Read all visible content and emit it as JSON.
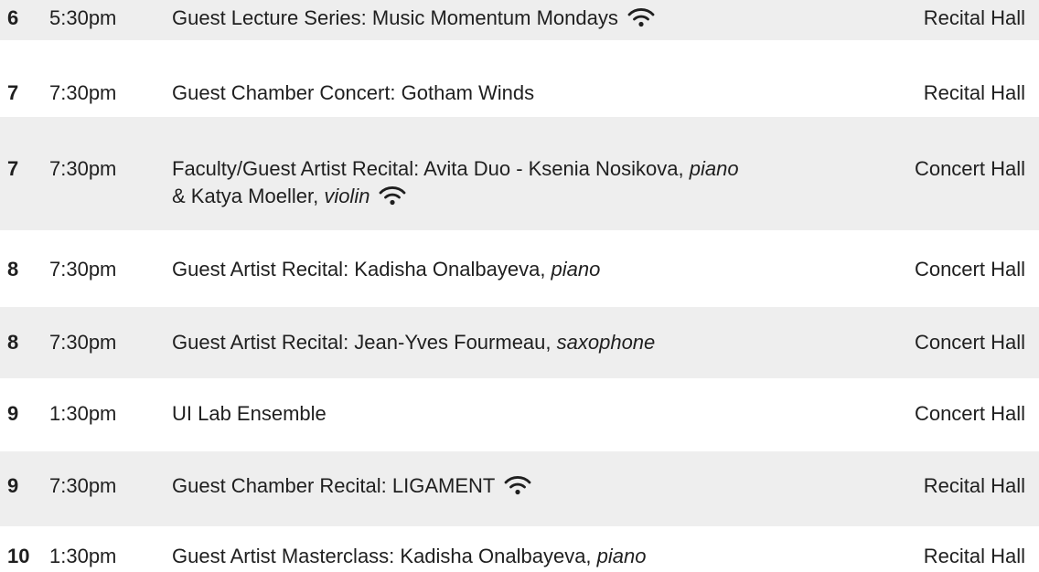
{
  "events": [
    {
      "day": "6",
      "time": "5:30pm",
      "title_parts": [
        "Guest Lecture Series: Music Momentum Mondays"
      ],
      "stream": true,
      "venue": "Recital Hall"
    },
    {
      "day": "7",
      "time": "7:30pm",
      "title_parts": [
        "Guest Chamber Concert: Gotham Winds"
      ],
      "stream": false,
      "venue": "Recital Hall"
    },
    {
      "day": "7",
      "time": "7:30pm",
      "title_parts": [
        "Faculty/Guest Artist Recital: Avita Duo - Ksenia Nosikova, ",
        "piano",
        "& Katya Moeller, ",
        "violin"
      ],
      "stream": true,
      "venue": "Concert Hall"
    },
    {
      "day": "8",
      "time": "7:30pm",
      "title_parts": [
        "Guest Artist Recital: Kadisha Onalbayeva, ",
        "piano"
      ],
      "stream": false,
      "venue": "Concert Hall"
    },
    {
      "day": "8",
      "time": "7:30pm",
      "title_parts": [
        "Guest Artist Recital: Jean-Yves Fourmeau, ",
        "saxophone"
      ],
      "stream": false,
      "venue": "Concert Hall"
    },
    {
      "day": "9",
      "time": "1:30pm",
      "title_parts": [
        "UI Lab Ensemble"
      ],
      "stream": false,
      "venue": "Concert Hall"
    },
    {
      "day": "9",
      "time": "7:30pm",
      "title_parts": [
        "Guest Chamber Recital: LIGAMENT"
      ],
      "stream": true,
      "venue": "Recital Hall"
    },
    {
      "day": "10",
      "time": "1:30pm",
      "title_parts": [
        "Guest Artist Masterclass: Kadisha Onalbayeva, ",
        "piano"
      ],
      "stream": false,
      "venue": "Recital Hall"
    }
  ],
  "icons": {
    "stream": "wifi-icon"
  },
  "colors": {
    "row_shade": "#eeeeee",
    "text": "#1f1f1f",
    "background": "#ffffff"
  }
}
